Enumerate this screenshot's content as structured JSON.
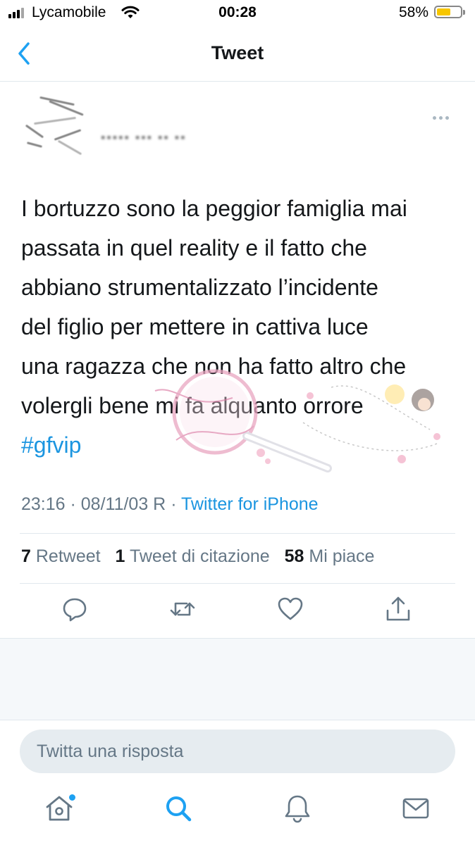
{
  "status_bar": {
    "carrier": "Lycamobile",
    "time": "00:28",
    "battery_percent": "58%",
    "battery_level": 0.58,
    "battery_color": "#f7c600"
  },
  "nav": {
    "back_icon": "chevron-left-icon",
    "title": "Tweet"
  },
  "tweet": {
    "more_icon": "ellipsis-icon",
    "text_lines": [
      "I bortuzzo sono la peggior famiglia mai",
      "passata in quel reality e il fatto che",
      "abbiano strumentalizzato l’incidente",
      "del figlio per mettere in cattiva luce",
      "una ragazza che non ha fatto altro che",
      "volergli bene mi fa alquanto orrore"
    ],
    "hashtag": "#gfvip",
    "timestamp": "23:16 · 08/11/03 R",
    "source": "Twitter for iPhone",
    "stats": {
      "retweets": "7",
      "retweets_label": "Retweet",
      "quotes": "1",
      "quotes_label": "Tweet di citazione",
      "likes": "58",
      "likes_label": "Mi piace"
    },
    "actions": [
      "reply-icon",
      "retweet-icon",
      "like-icon",
      "share-icon"
    ]
  },
  "reply": {
    "placeholder": "Twitta una risposta",
    "value": ""
  },
  "tab_bar": {
    "items": [
      "home-icon",
      "search-icon",
      "notifications-icon",
      "messages-icon"
    ],
    "active": "search-icon"
  },
  "colors": {
    "accent": "#1da1f2",
    "link": "#1b95e0",
    "text": "#14171a",
    "secondary": "#657786"
  }
}
